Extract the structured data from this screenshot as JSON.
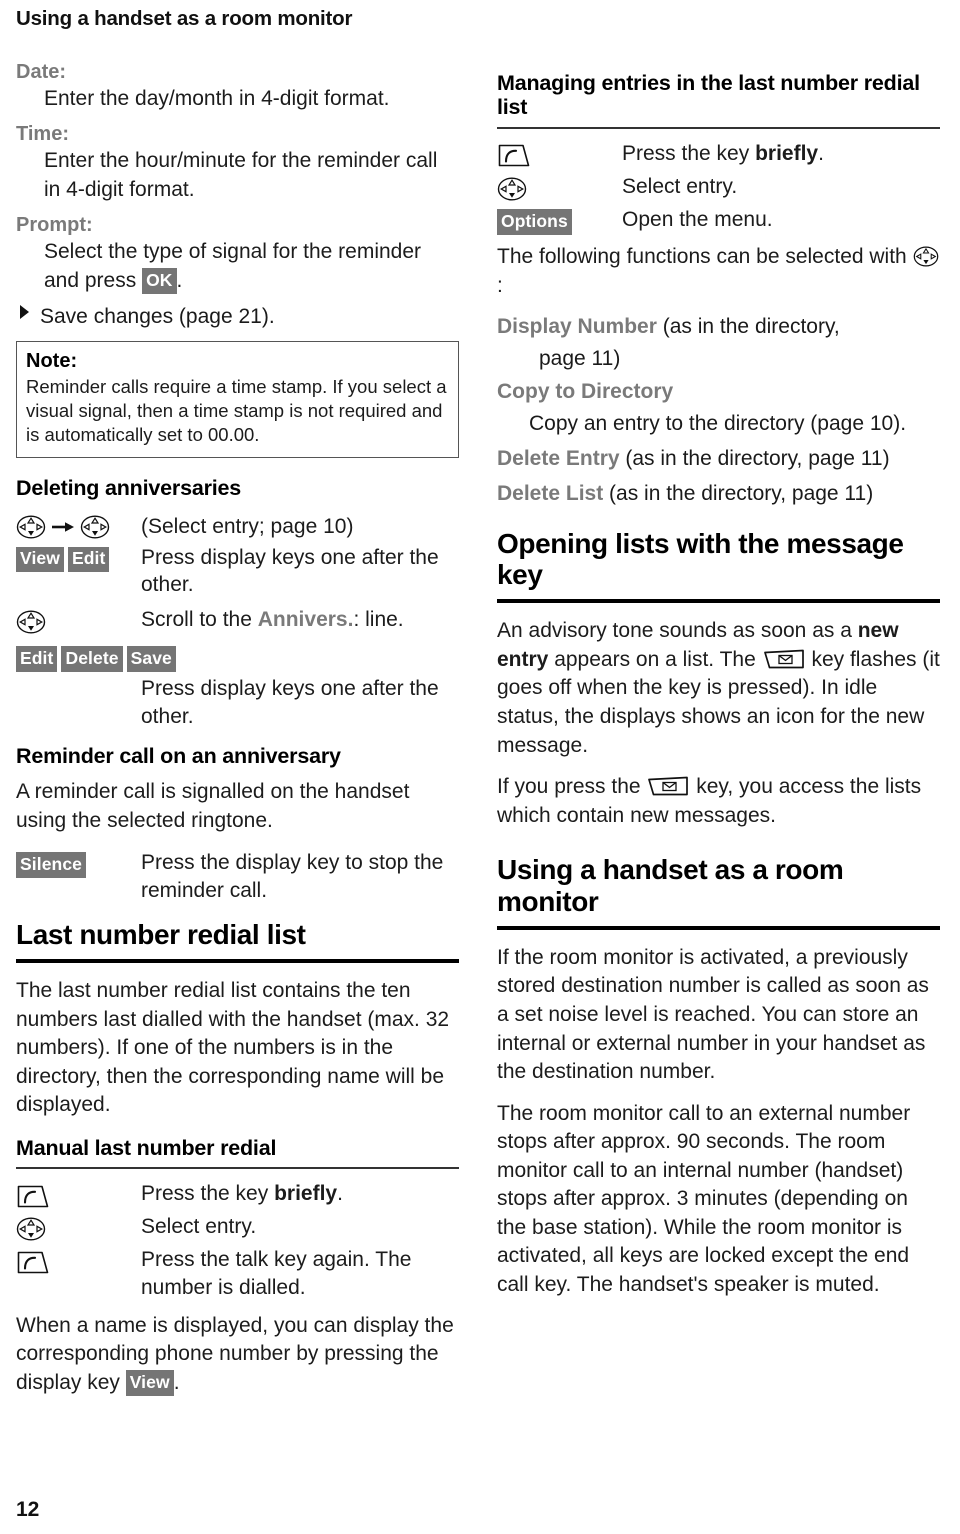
{
  "running_head": "Using a handset as a room monitor",
  "folio": "12",
  "left_column": {
    "definitions": [
      {
        "term": "Date:",
        "definition": "Enter the day/month in 4-digit format."
      },
      {
        "term": "Time:",
        "definition": "Enter the hour/minute for the reminder call in 4-digit format."
      },
      {
        "term": "Prompt:",
        "definition_pre": "Select the type of signal for the reminder and press ",
        "definition_key": "OK",
        "definition_post": "."
      }
    ],
    "save_step": "Save changes (page 21).",
    "note": {
      "title": "Note:",
      "body": "Reminder calls require a time stamp. If you select a visual signal, then a time stamp is not required and is automatically set to 00.00."
    },
    "deleting_anniversaries": {
      "heading": "Deleting anniversaries",
      "nav_line_text": "(Select entry; page 10)",
      "steps": [
        {
          "keys": [
            "View",
            "Edit"
          ],
          "text": "Press display keys one after the other."
        },
        {
          "keys": [],
          "icon": "nav",
          "text_pre": "Scroll to the ",
          "text_em": "Annivers.",
          "text_post": ": line."
        },
        {
          "keys": [
            "Edit",
            "Delete",
            "Save"
          ],
          "text": "Press display keys one after the other."
        }
      ]
    },
    "reminder_call": {
      "heading": "Reminder call on an anniversary",
      "body": "A reminder call is signalled on the handset using the selected ringtone.",
      "step_key": "Silence",
      "step_text": "Press the display key to stop the reminder call."
    },
    "last_number_redial_list": {
      "heading": "Last number redial list",
      "body": "The last number redial list contains the ten numbers last dialled with the handset (max. 32 numbers). If one of the numbers is in the directory, then the corresponding name will be displayed."
    },
    "manual_last_number_redial": {
      "heading": "Manual last number redial",
      "steps": [
        {
          "icon": "talk",
          "text_pre": "Press the key ",
          "text_em": "briefly",
          "text_post": "."
        },
        {
          "icon": "nav",
          "text": "Select entry."
        },
        {
          "icon": "talk",
          "text": "Press the talk key again. The number is dialled."
        }
      ],
      "closing_pre": "When a name is displayed, you can display the corresponding phone number by pressing the display key ",
      "closing_key": "View",
      "closing_post": "."
    }
  },
  "right_column": {
    "managing_entries": {
      "heading": "Managing entries in the last number redial list",
      "steps": [
        {
          "icon": "talk",
          "text_pre": "Press the key ",
          "text_em": "briefly",
          "text_post": "."
        },
        {
          "icon": "nav",
          "text": "Select entry."
        },
        {
          "key": "Options",
          "text": "Open the menu."
        }
      ],
      "intro_pre": "The following functions can be selected with ",
      "intro_post": ":",
      "functions": [
        {
          "name": "Display Number",
          "rest": " (as in the directory,",
          "indent_line": "page 11)"
        },
        {
          "name": "Copy to Directory",
          "rest": "",
          "desc": "Copy an entry to the directory (page 10)."
        },
        {
          "name": "Delete Entry",
          "rest": " (as in the directory, page 11)"
        },
        {
          "name": "Delete List",
          "rest": " (as in the directory, page 11)"
        }
      ]
    },
    "opening_lists": {
      "heading": "Opening lists with the message key",
      "para1_a": "An advisory tone sounds as soon as a ",
      "para1_em1": "new entry",
      "para1_b": " appears on a list. The ",
      "para1_c": " key flashes (it goes off when the key is pressed). In idle status, the displays shows an icon for the new message.",
      "para2_a": "If you press the ",
      "para2_b": " key, you access the lists which contain new messages."
    },
    "room_monitor": {
      "heading": "Using a handset as a room monitor",
      "para1": "If the room monitor is activated, a previously stored destination number is called as soon as a set noise level is reached. You can store an internal or external number in your handset as the destination number.",
      "para2": "The room monitor call to an external number stops after approx. 90 seconds. The room monitor call to an internal number (handset) stops after approx. 3 minutes (depending on the base station). While the room monitor is activated, all keys are locked except the end call key. The handset's speaker is muted."
    }
  }
}
